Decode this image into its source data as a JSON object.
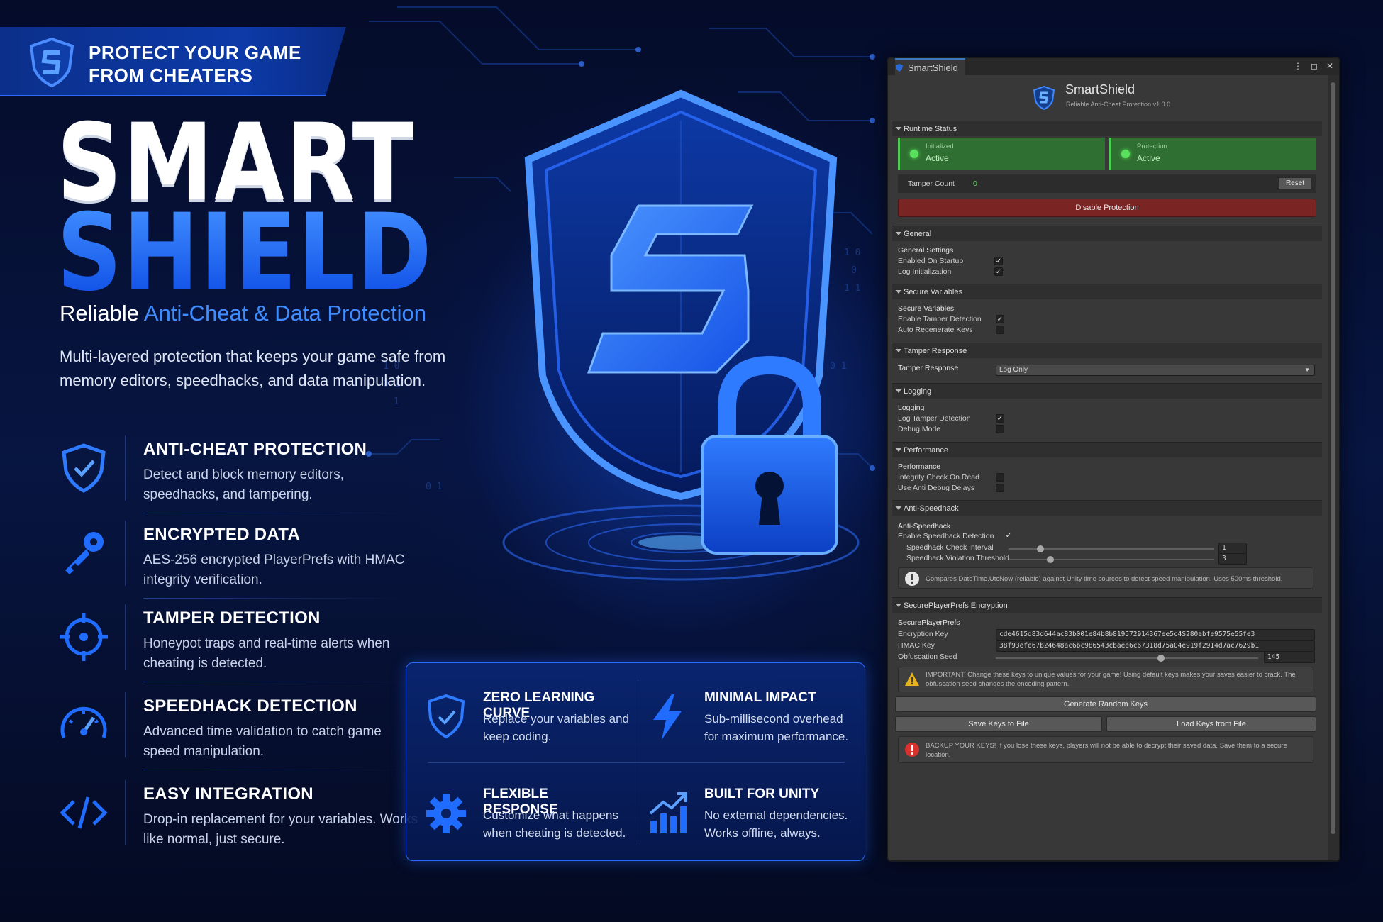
{
  "banner": {
    "line1": "PROTECT YOUR GAME",
    "line2": "FROM CHEATERS"
  },
  "hero": {
    "title_line1": "SMART",
    "title_line2": "SHIELD",
    "subtitle_plain": "Reliable",
    "subtitle_accent": "Anti-Cheat & Data Protection",
    "description": "Multi-layered protection that keeps your game safe from memory editors, speedhacks, and data manipulation."
  },
  "features": [
    {
      "icon": "shield-check-icon",
      "title": "ANTI-CHEAT PROTECTION",
      "text": "Detect and block memory editors, speedhacks, and tampering."
    },
    {
      "icon": "key-icon",
      "title": "ENCRYPTED DATA",
      "text": "AES-256 encrypted PlayerPrefs with HMAC integrity verification."
    },
    {
      "icon": "crosshair-icon",
      "title": "TAMPER DETECTION",
      "text": "Honeypot traps and real-time alerts when cheating is detected."
    },
    {
      "icon": "speedometer-icon",
      "title": "SPEEDHACK DETECTION",
      "text": "Advanced time validation to catch game speed manipulation."
    },
    {
      "icon": "code-icon",
      "title": "EASY INTEGRATION",
      "text": "Drop-in replacement for your variables. Works like normal, just secure."
    }
  ],
  "box_features": [
    {
      "icon": "shield-check-icon",
      "title": "ZERO LEARNING CURVE",
      "text": "Replace your variables and keep coding."
    },
    {
      "icon": "lightning-icon",
      "title": "MINIMAL IMPACT",
      "text": "Sub-millisecond overhead for maximum performance."
    },
    {
      "icon": "gear-icon",
      "title": "FLEXIBLE RESPONSE",
      "text": "Customize what happens when cheating is detected."
    },
    {
      "icon": "growth-chart-icon",
      "title": "BUILT FOR UNITY",
      "text": "No external dependencies. Works offline, always."
    }
  ],
  "colors": {
    "accent": "#1e6cff",
    "background": "#071541",
    "editor_bg": "#383838",
    "status_green": "#2f6f31",
    "danger_red": "#7a2424"
  },
  "editor": {
    "tab_title": "SmartShield",
    "header_name": "SmartShield",
    "header_version": "Reliable Anti-Cheat Protection v1.0.0",
    "runtime": {
      "section": "Runtime Status",
      "initialized_label": "Initialized",
      "initialized_value": "Active",
      "protection_label": "Protection",
      "protection_value": "Active",
      "tamper_count_label": "Tamper Count",
      "tamper_count_value": "0",
      "reset_label": "Reset",
      "disable_label": "Disable Protection"
    },
    "general": {
      "section": "General",
      "group": "General Settings",
      "enabled_on_startup": "Enabled On Startup",
      "log_initialization": "Log Initialization"
    },
    "secure_variables": {
      "section": "Secure Variables",
      "group": "Secure Variables",
      "enable_tamper_detection": "Enable Tamper Detection",
      "auto_regenerate_keys": "Auto Regenerate Keys"
    },
    "tamper_response": {
      "section": "Tamper Response",
      "label": "Tamper Response",
      "value": "Log Only"
    },
    "logging": {
      "section": "Logging",
      "group": "Logging",
      "log_tamper_detection": "Log Tamper Detection",
      "debug_mode": "Debug Mode"
    },
    "performance": {
      "section": "Performance",
      "group": "Performance",
      "integrity_check": "Integrity Check On Read",
      "anti_debug": "Use Anti Debug Delays"
    },
    "anti_speedhack": {
      "section": "Anti-Speedhack",
      "group": "Anti-Speedhack",
      "enable_label": "Enable Speedhack Detection",
      "interval_label": "Speedhack Check Interval",
      "interval_value": "1",
      "threshold_label": "Speedhack Violation Threshold",
      "threshold_value": "3",
      "info": "Compares DateTime.UtcNow (reliable) against Unity time sources to detect speed manipulation. Uses 500ms threshold."
    },
    "encryption": {
      "section": "SecurePlayerPrefs Encryption",
      "group": "SecurePlayerPrefs",
      "enc_key_label": "Encryption Key",
      "enc_key_value": "cde4615d83d644ac83b001e84b8b819572914367ee5c4S280abfe9575e55fe3",
      "hmac_label": "HMAC Key",
      "hmac_value": "38f93efe67b24648ac6bc986543cbaee6c67318d75a04e919f2914d7ac7629b1",
      "seed_label": "Obfuscation Seed",
      "seed_value": "145",
      "warning": "IMPORTANT: Change these keys to unique values for your game! Using default keys makes your saves easier to crack. The obfuscation seed changes the encoding pattern.",
      "generate_label": "Generate Random Keys",
      "save_label": "Save Keys to File",
      "load_label": "Load Keys from File",
      "backup": "BACKUP YOUR KEYS! If you lose these keys, players will not be able to decrypt their saved data. Save them to a secure location."
    }
  }
}
